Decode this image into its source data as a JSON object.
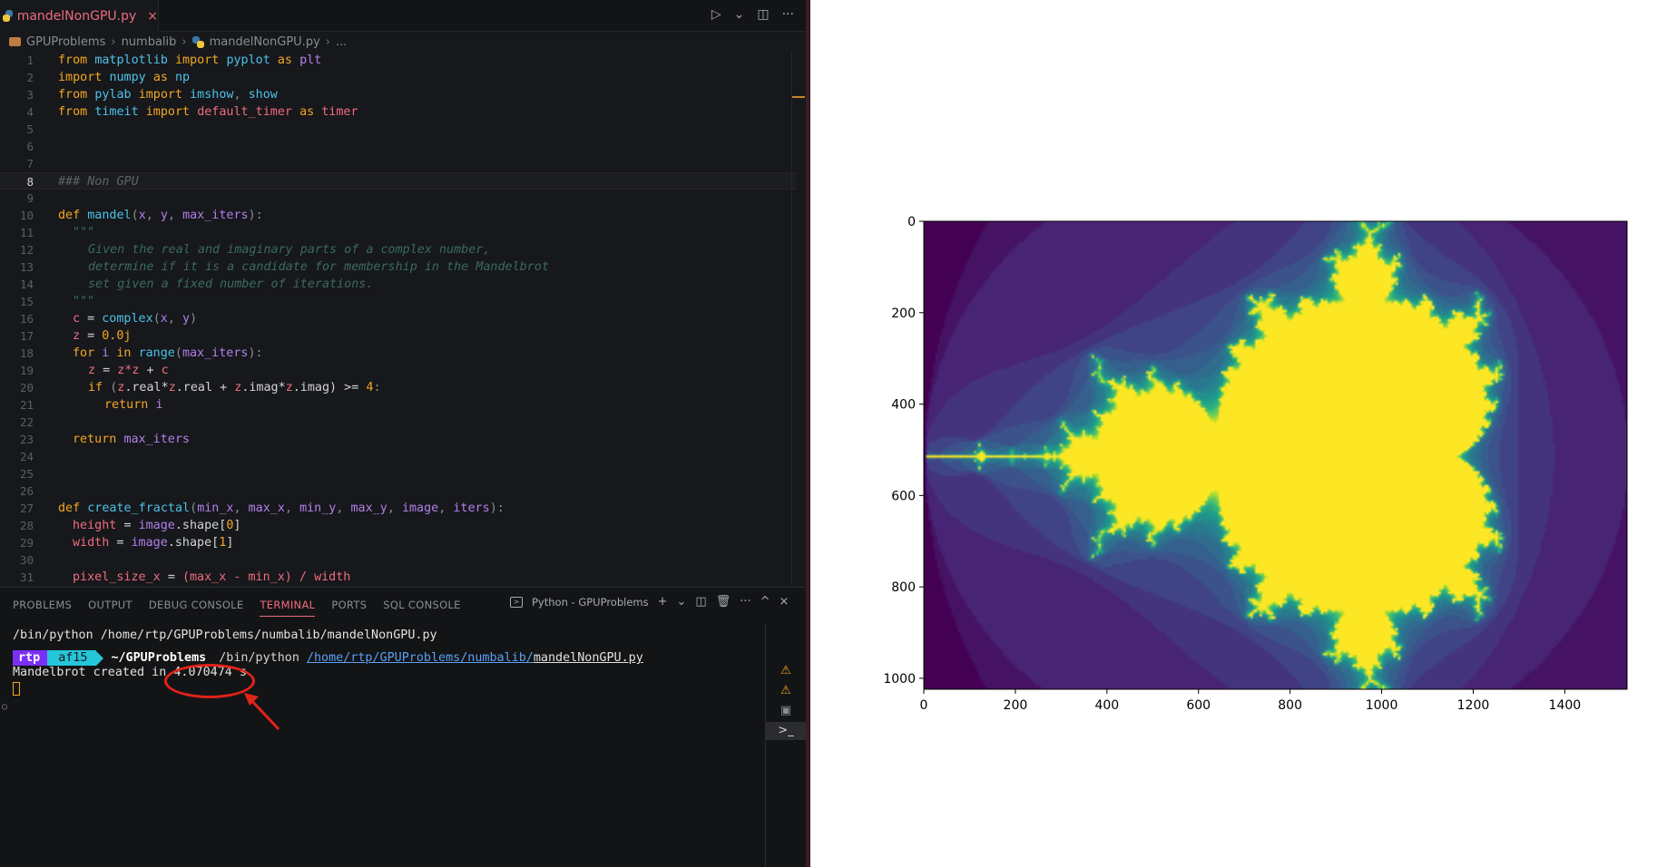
{
  "editor": {
    "tab_label": "mandelNonGPU.py",
    "tab_close": "×",
    "actions": {
      "run": "▷",
      "run_menu": "⌄",
      "split": "◫",
      "more": "···"
    },
    "breadcrumb": [
      "GPUProblems",
      "numbalib",
      "mandelNonGPU.py",
      "..."
    ],
    "breadcrumb_sep": "›",
    "lines": [
      {
        "n": "1"
      },
      {
        "n": "2"
      },
      {
        "n": "3"
      },
      {
        "n": "4"
      },
      {
        "n": "5"
      },
      {
        "n": "6"
      },
      {
        "n": "7"
      },
      {
        "n": "8"
      },
      {
        "n": "9"
      },
      {
        "n": "10"
      },
      {
        "n": "11"
      },
      {
        "n": "12"
      },
      {
        "n": "13"
      },
      {
        "n": "14"
      },
      {
        "n": "15"
      },
      {
        "n": "16"
      },
      {
        "n": "17"
      },
      {
        "n": "18"
      },
      {
        "n": "19"
      },
      {
        "n": "20"
      },
      {
        "n": "21"
      },
      {
        "n": "22"
      },
      {
        "n": "23"
      },
      {
        "n": "24"
      },
      {
        "n": "25"
      },
      {
        "n": "26"
      },
      {
        "n": "27"
      },
      {
        "n": "28"
      },
      {
        "n": "29"
      },
      {
        "n": "30"
      },
      {
        "n": "31"
      }
    ],
    "code": {
      "l1": [
        "from",
        "matplotlib",
        "import",
        "pyplot",
        "as",
        "plt"
      ],
      "l2": [
        "import",
        "numpy",
        "as",
        "np"
      ],
      "l3": [
        "from",
        "pylab",
        "import",
        "imshow",
        ",",
        "show"
      ],
      "l4": [
        "from",
        "timeit",
        "import",
        "default_timer",
        "as",
        "timer"
      ],
      "l8": "### Non GPU",
      "l10": [
        "def",
        "mandel",
        "(",
        "x",
        ",",
        "y",
        ",",
        "max_iters",
        "):"
      ],
      "l11": "\"\"\"",
      "l12": "Given the real and imaginary parts of a complex number,",
      "l13": "determine if it is a candidate for membership in the Mandelbrot",
      "l14": "set given a fixed number of iterations.",
      "l15": "\"\"\"",
      "l16": [
        "c",
        "=",
        "complex",
        "(",
        "x",
        ",",
        "y",
        ")"
      ],
      "l17": [
        "z",
        "=",
        "0.0j"
      ],
      "l18": [
        "for",
        "i",
        "in",
        "range",
        "(",
        "max_iters",
        "):"
      ],
      "l19": [
        "z",
        "=",
        "z*z",
        "+",
        "c"
      ],
      "l20": [
        "if",
        "(",
        "z",
        ".real*",
        "z",
        ".real +",
        "z",
        ".imag*",
        "z",
        ".imag) >=",
        "4",
        ":"
      ],
      "l21": [
        "return",
        "i"
      ],
      "l23": [
        "return",
        "max_iters"
      ],
      "l27": [
        "def",
        "create_fractal",
        "(",
        "min_x",
        ",",
        "max_x",
        ",",
        "min_y",
        ",",
        "max_y",
        ",",
        "image",
        ",",
        "iters",
        "):"
      ],
      "l28": [
        "height",
        "=",
        "image",
        ".shape[",
        "0",
        "]"
      ],
      "l29": [
        "width",
        "=",
        "image",
        ".shape[",
        "1",
        "]"
      ],
      "l31": [
        "pixel_size_x",
        "=",
        "(max_x - min_x) /",
        "width"
      ]
    }
  },
  "panel": {
    "tabs": [
      "PROBLEMS",
      "OUTPUT",
      "DEBUG CONSOLE",
      "TERMINAL",
      "PORTS",
      "SQL CONSOLE"
    ],
    "active_tab": "TERMINAL",
    "terminal_name": "Python - GPUProblems",
    "actions": {
      "add": "+",
      "add_menu": "⌄",
      "split": "◫",
      "trash": "🗑",
      "more": "···",
      "maximize": "^",
      "close": "×"
    },
    "terminal": {
      "line1": "/bin/python /home/rtp/GPUProblems/numbalib/mandelNonGPU.py",
      "prompt_user": "rtp",
      "prompt_hash": "af15",
      "prompt_dir": "~/GPUProblems",
      "prompt_cmd": "/bin/python",
      "prompt_path": "/home/rtp/GPUProblems/numbalib/",
      "prompt_file": "mandelNonGPU.py",
      "result_prefix": "Mandelbrot created in ",
      "result_value": "4.070474 s"
    }
  },
  "chart_data": {
    "type": "heatmap",
    "title": "",
    "xlabel": "",
    "ylabel": "",
    "xticks": [
      "0",
      "200",
      "400",
      "600",
      "800",
      "1000",
      "1200",
      "1400"
    ],
    "yticks": [
      "0",
      "200",
      "400",
      "600",
      "800",
      "1000"
    ],
    "xlim": [
      0,
      1536
    ],
    "ylim": [
      1024,
      0
    ],
    "colormap": "viridis",
    "colors": {
      "inside": "#fde725",
      "edge": "#21918c",
      "background": "#440154"
    }
  }
}
